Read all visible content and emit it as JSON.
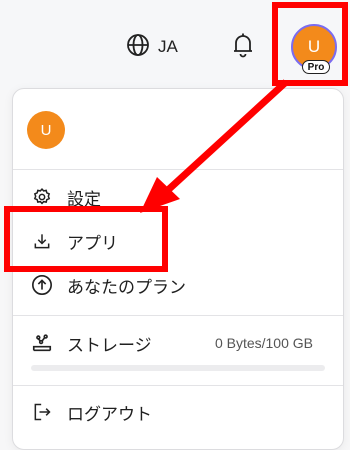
{
  "header": {
    "language": "JA",
    "avatar_initial": "U",
    "plan_badge": "Pro"
  },
  "menu": {
    "avatar_initial": "U",
    "items": {
      "settings": "設定",
      "apps": "アプリ",
      "plan": "あなたのプラン",
      "storage": "ストレージ",
      "logout": "ログアウト"
    },
    "storage_usage": "0 Bytes/100 GB",
    "storage_fill_fraction": 0
  },
  "colors": {
    "avatar": "#f38a1b",
    "annotation": "#ff0000"
  },
  "icons": {
    "language": "globe-icon",
    "notifications": "bell-icon",
    "settings": "gear-icon",
    "apps": "download-icon",
    "plan": "upgrade-arrow-icon",
    "storage": "storage-icon",
    "logout": "logout-icon"
  }
}
